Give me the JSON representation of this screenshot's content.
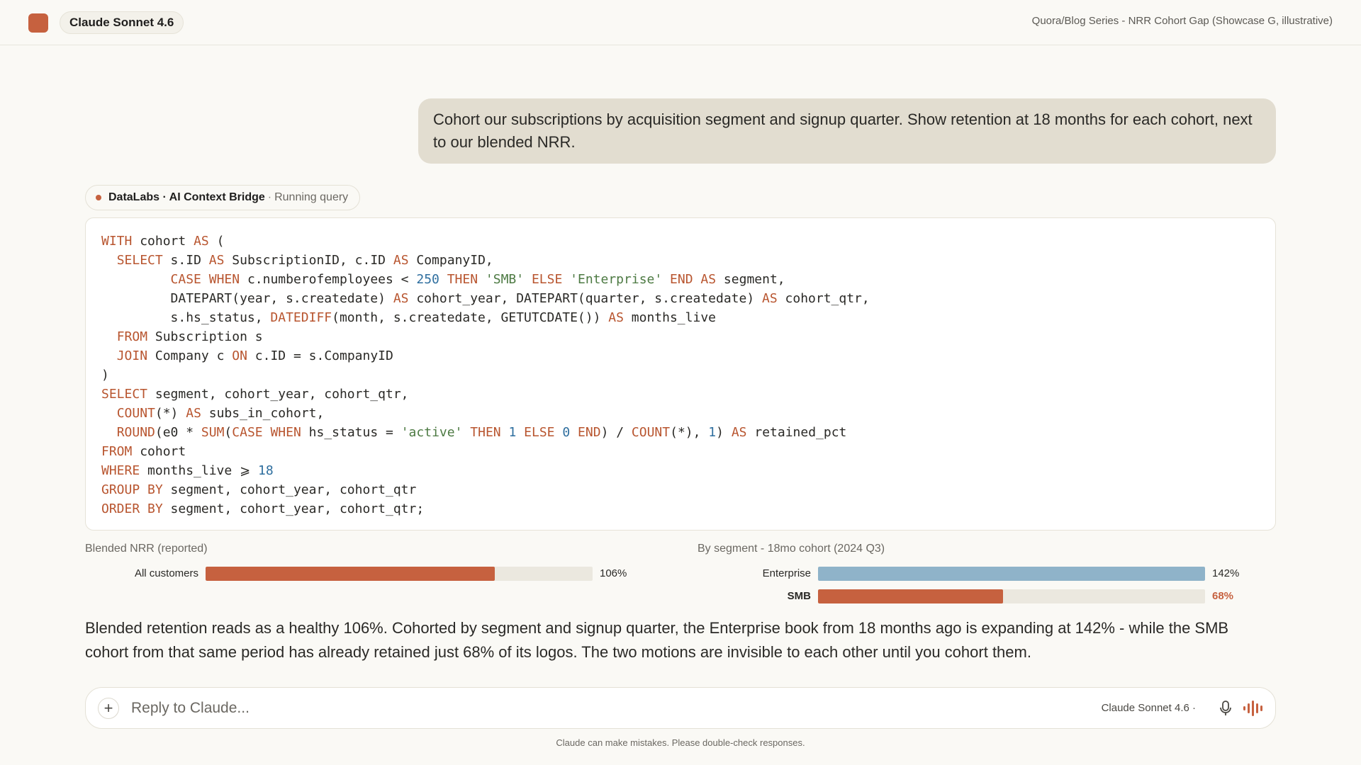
{
  "header": {
    "model_label": "Claude Sonnet 4.6",
    "page_title": "Quora/Blog Series - NRR Cohort Gap (Showcase G, illustrative)"
  },
  "user_message": "Cohort our subscriptions by acquisition segment and signup quarter. Show retention at 18 months for each cohort, next to our blended NRR.",
  "tool_call": {
    "name": "DataLabs · AI Context Bridge",
    "separator": "·",
    "status": "Running query"
  },
  "sql_code": "WITH cohort AS (\n  SELECT s.ID AS SubscriptionID, c.ID AS CompanyID,\n         CASE WHEN c.numberofemployees < 250 THEN 'SMB' ELSE 'Enterprise' END AS segment,\n         DATEPART(year, s.createdate) AS cohort_year, DATEPART(quarter, s.createdate) AS cohort_qtr,\n         s.hs_status, DATEDIFF(month, s.createdate, GETUTCDATE()) AS months_live\n  FROM Subscription s\n  JOIN Company c ON c.ID = s.CompanyID\n)\nSELECT segment, cohort_year, cohort_qtr,\n  COUNT(*) AS subs_in_cohort,\n  ROUND(e0 * SUM(CASE WHEN hs_status = 'active' THEN 1 ELSE 0 END) / COUNT(*), 1) AS retained_pct\nFROM cohort\nWHERE months_live ⩾ 18\nGROUP BY segment, cohort_year, cohort_qtr\nORDER BY segment, cohort_year, cohort_qtr;",
  "chart_data": [
    {
      "type": "bar",
      "orientation": "horizontal",
      "title": "Blended NRR (reported)",
      "xlim": [
        0,
        142
      ],
      "categories": [
        "All customers"
      ],
      "values": [
        106
      ],
      "value_labels": [
        "106%"
      ],
      "colors": [
        "#c6613f"
      ]
    },
    {
      "type": "bar",
      "orientation": "horizontal",
      "title": "By segment - 18mo cohort (2024 Q3)",
      "xlim": [
        0,
        142
      ],
      "categories": [
        "Enterprise",
        "SMB"
      ],
      "values": [
        142,
        68
      ],
      "value_labels": [
        "142%",
        "68%"
      ],
      "colors": [
        "#8fb3c9",
        "#c6613f"
      ]
    }
  ],
  "answer": "Blended retention reads as a healthy 106%. Cohorted by segment and signup quarter, the Enterprise book from 18 months ago is expanding at 142% - while the SMB cohort from that same period has already retained just 68% of its logos. The two motions are invisible to each other until you cohort them.",
  "composer": {
    "placeholder": "Reply to Claude...",
    "plus_label": "+",
    "model_label": "Claude Sonnet 4.6 ·"
  },
  "disclaimer": "Claude can make mistakes. Please double-check responses.",
  "colors": {
    "accent": "#c6613f",
    "enterprise": "#8fb3c9",
    "track": "#ebe8df"
  }
}
